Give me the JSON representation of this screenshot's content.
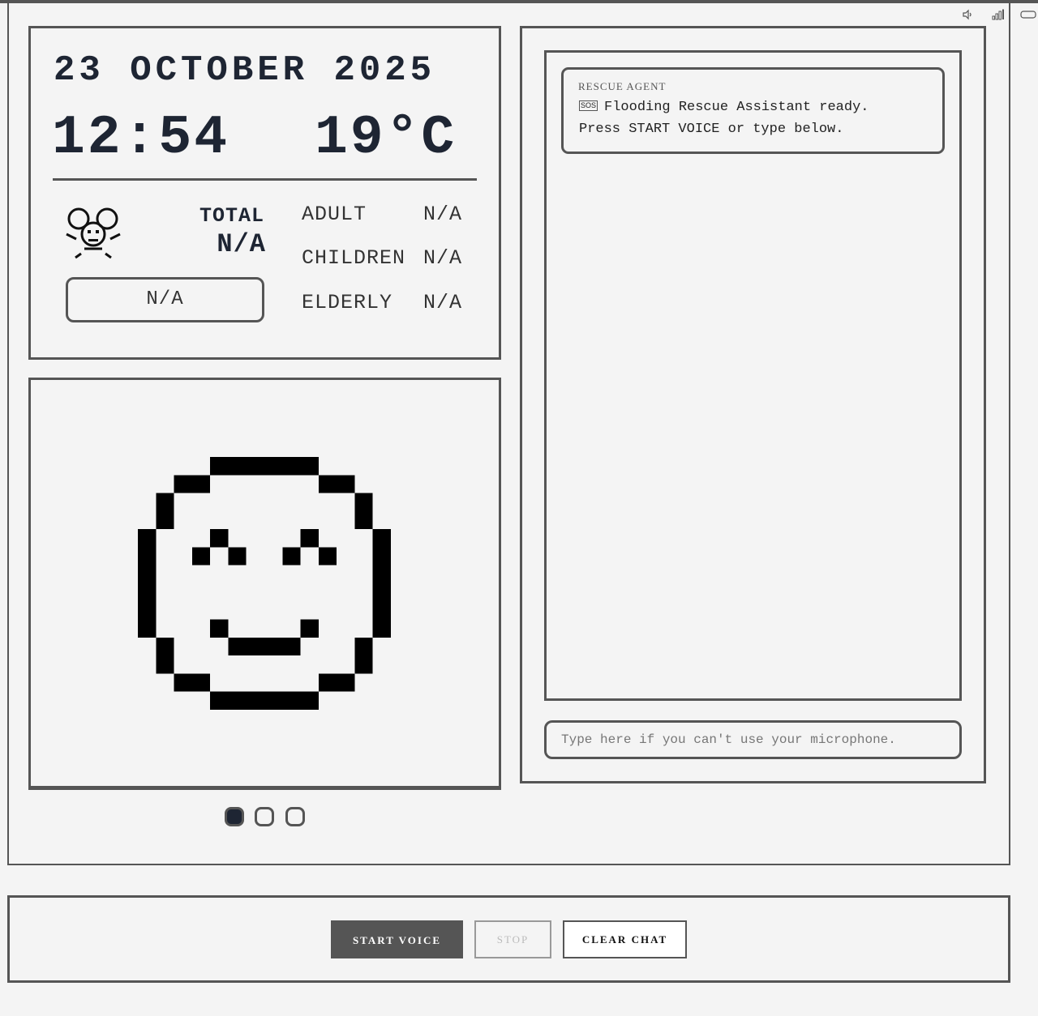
{
  "header": {
    "date": "23 OCTOBER 2025",
    "time": "12:54",
    "temperature": "19°C"
  },
  "headcount": {
    "total_label": "TOTAL",
    "total_value": "N/A",
    "status": "N/A",
    "rows": [
      {
        "label": "ADULT",
        "value": "N/A"
      },
      {
        "label": "CHILDREN",
        "value": "N/A"
      },
      {
        "label": "ELDERLY",
        "value": "N/A"
      }
    ]
  },
  "carousel": {
    "pages": 3,
    "active_index": 0
  },
  "chat": {
    "messages": [
      {
        "sender": "RESCUE AGENT",
        "icon": "sos-icon",
        "line1": "Flooding Rescue Assistant ready.",
        "line2": "Press START VOICE or type below."
      }
    ],
    "input_placeholder": "Type here if you can't use your microphone."
  },
  "controls": {
    "start_label": "START VOICE",
    "stop_label": "STOP",
    "clear_label": "CLEAR CHAT"
  },
  "colors": {
    "border": "#555555",
    "background": "#f4f4f4",
    "text": "#1e2533"
  }
}
